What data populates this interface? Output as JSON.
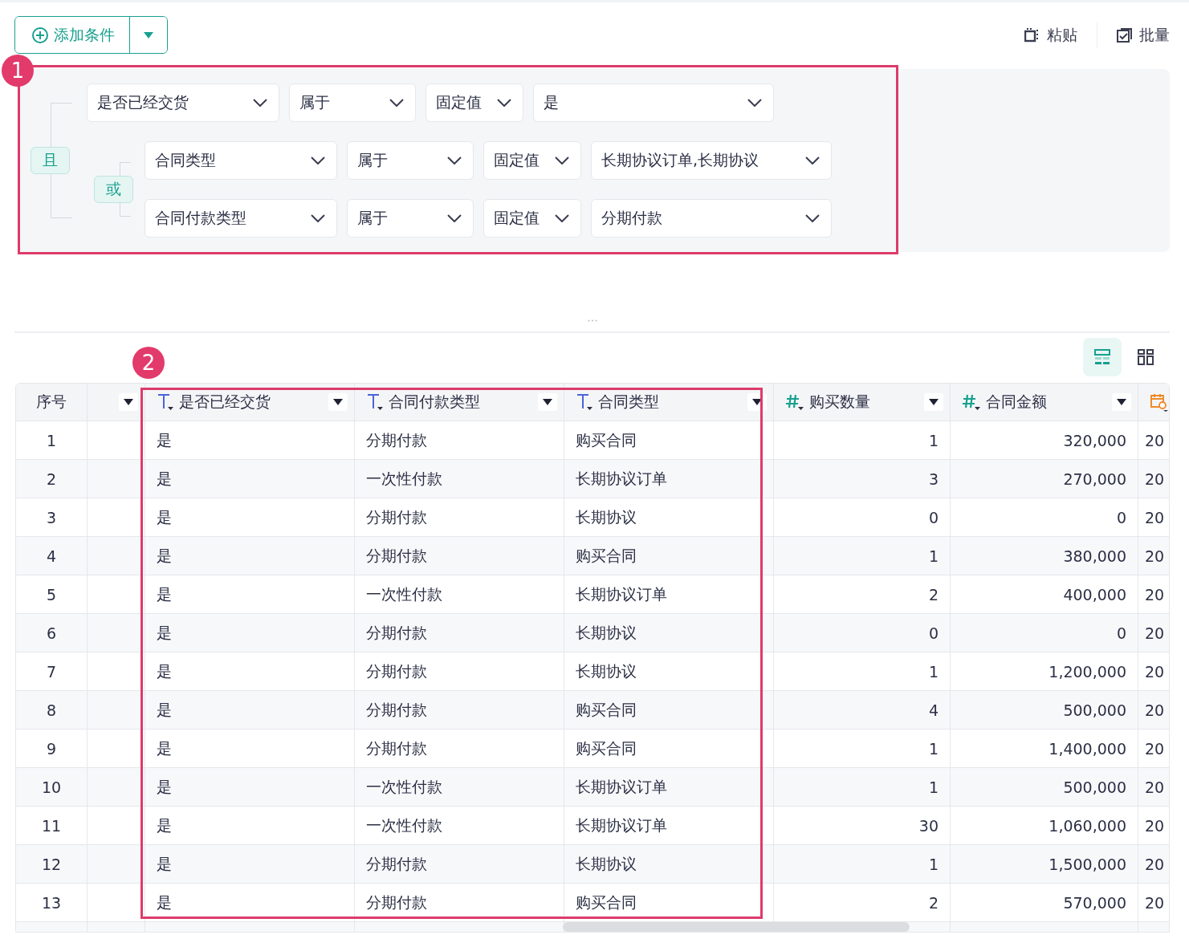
{
  "toolbar": {
    "add_button": {
      "label": "添加条件"
    },
    "actions": [
      {
        "kind": "paste",
        "label": "粘贴"
      },
      {
        "kind": "batch",
        "label": "批量"
      }
    ]
  },
  "filter": {
    "logic": "且",
    "conditions": [
      {
        "field": "是否已经交货",
        "operator": "属于",
        "value_type": "固定值",
        "value": "是"
      }
    ],
    "group": {
      "logic": "或",
      "conditions": [
        {
          "field": "合同类型",
          "operator": "属于",
          "value_type": "固定值",
          "value": "长期协议订单,长期协议"
        },
        {
          "field": "合同付款类型",
          "operator": "属于",
          "value_type": "固定值",
          "value": "分期付款"
        }
      ]
    }
  },
  "annotations": [
    {
      "label": "1"
    },
    {
      "label": "2"
    }
  ],
  "view_toggle": [
    {
      "kind": "list",
      "selected": true
    },
    {
      "kind": "grid",
      "selected": false
    }
  ],
  "table": {
    "columns": [
      {
        "kind": "index",
        "label": "序号"
      },
      {
        "kind": "blank"
      },
      {
        "kind": "text",
        "label": "是否已经交货"
      },
      {
        "kind": "text",
        "label": "合同付款类型"
      },
      {
        "kind": "text",
        "label": "合同类型"
      },
      {
        "kind": "number",
        "label": "购买数量"
      },
      {
        "kind": "number",
        "label": "合同金额"
      },
      {
        "kind": "date"
      }
    ],
    "rows": [
      {
        "cells": [
          "1",
          "",
          "是",
          "分期付款",
          "购买合同",
          "1",
          "320,000",
          "20"
        ]
      },
      {
        "cells": [
          "2",
          "",
          "是",
          "一次性付款",
          "长期协议订单",
          "3",
          "270,000",
          "20"
        ]
      },
      {
        "cells": [
          "3",
          "",
          "是",
          "分期付款",
          "长期协议",
          "0",
          "0",
          "20"
        ]
      },
      {
        "cells": [
          "4",
          "",
          "是",
          "分期付款",
          "购买合同",
          "1",
          "380,000",
          "20"
        ]
      },
      {
        "cells": [
          "5",
          "",
          "是",
          "一次性付款",
          "长期协议订单",
          "2",
          "400,000",
          "20"
        ]
      },
      {
        "cells": [
          "6",
          "",
          "是",
          "分期付款",
          "长期协议",
          "0",
          "0",
          "20"
        ]
      },
      {
        "cells": [
          "7",
          "",
          "是",
          "分期付款",
          "长期协议",
          "1",
          "1,200,000",
          "20"
        ]
      },
      {
        "cells": [
          "8",
          "",
          "是",
          "分期付款",
          "购买合同",
          "4",
          "500,000",
          "20"
        ]
      },
      {
        "cells": [
          "9",
          "",
          "是",
          "分期付款",
          "购买合同",
          "1",
          "1,400,000",
          "20"
        ]
      },
      {
        "cells": [
          "10",
          "",
          "是",
          "一次性付款",
          "长期协议订单",
          "1",
          "500,000",
          "20"
        ]
      },
      {
        "cells": [
          "11",
          "",
          "是",
          "一次性付款",
          "长期协议订单",
          "30",
          "1,060,000",
          "20"
        ]
      },
      {
        "cells": [
          "12",
          "",
          "是",
          "分期付款",
          "长期协议",
          "1",
          "1,500,000",
          "20"
        ]
      },
      {
        "cells": [
          "13",
          "",
          "是",
          "分期付款",
          "购买合同",
          "2",
          "570,000",
          "20"
        ]
      }
    ]
  }
}
